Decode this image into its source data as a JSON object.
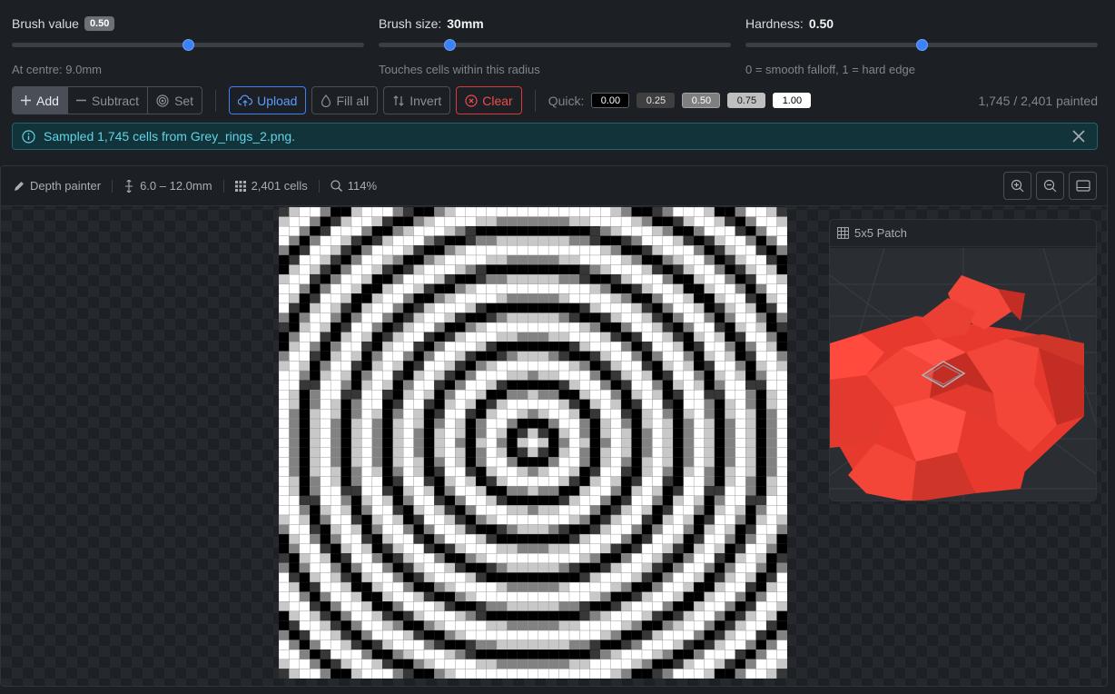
{
  "sliders": {
    "brush_value": {
      "label": "Brush value",
      "value": "0.50",
      "position": 0.5,
      "help": "At centre: 9.0mm"
    },
    "brush_size": {
      "label": "Brush size:",
      "value": "30mm",
      "position": 0.2,
      "help": "Touches cells within this radius"
    },
    "hardness": {
      "label": "Hardness:",
      "value": "0.50",
      "position": 0.5,
      "help": "0 = smooth falloff, 1 = hard edge"
    }
  },
  "toolbar": {
    "modes": [
      "Add",
      "Subtract",
      "Set"
    ],
    "active_mode": "Add",
    "upload": "Upload",
    "fill_all": "Fill all",
    "invert": "Invert",
    "clear": "Clear",
    "quick_label": "Quick:",
    "quick_values": [
      "0.00",
      "0.25",
      "0.50",
      "0.75",
      "1.00"
    ],
    "painted": "1,745 / 2,401 painted"
  },
  "alert": {
    "message": "Sampled 1,745 cells from Grey_rings_2.png."
  },
  "canvas": {
    "mode": "Depth painter",
    "depth_range": "6.0 – 12.0mm",
    "cells": "2,401 cells",
    "zoom": "114%"
  },
  "patch": {
    "title": "5x5 Patch"
  },
  "colors": {
    "accent": "#3b82f6",
    "danger": "#ef4c4c",
    "info": "#5fd4e6",
    "patch_block": "#f2463a"
  },
  "grid": {
    "cols": 49,
    "rows": 49
  }
}
